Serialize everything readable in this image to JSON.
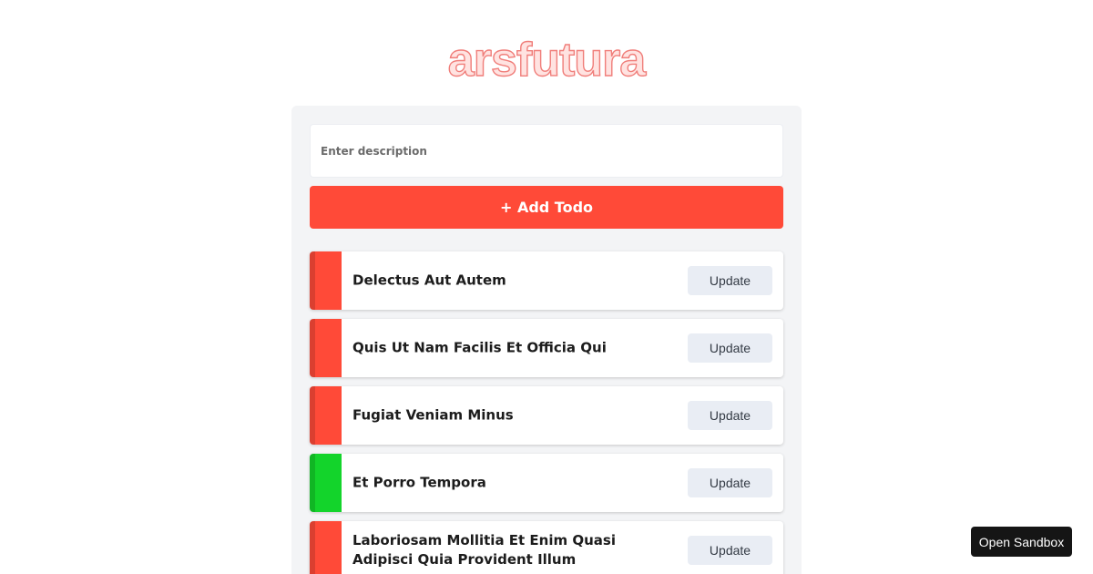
{
  "app": {
    "logo_text": "arsfutura"
  },
  "form": {
    "description_placeholder": "Enter description",
    "description_value": "",
    "add_button_label": "+ Add Todo"
  },
  "colors": {
    "accent": "#ff4a38",
    "pending_status": "#ff4a38",
    "done_status": "#13d42b",
    "panel_background": "#f3f4f6"
  },
  "todos": [
    {
      "title": "Delectus Aut Autem",
      "status": "pending",
      "status_color": "#ff4a38",
      "action_label": "Update"
    },
    {
      "title": "Quis Ut Nam Facilis Et Officia Qui",
      "status": "pending",
      "status_color": "#ff4a38",
      "action_label": "Update"
    },
    {
      "title": "Fugiat Veniam Minus",
      "status": "pending",
      "status_color": "#ff4a38",
      "action_label": "Update"
    },
    {
      "title": "Et Porro Tempora",
      "status": "done",
      "status_color": "#13d42b",
      "action_label": "Update"
    },
    {
      "title": "Laboriosam Mollitia Et Enim Quasi Adipisci Quia Provident Illum",
      "status": "pending",
      "status_color": "#ff4a38",
      "action_label": "Update"
    }
  ],
  "sandbox": {
    "button_label": "Open Sandbox"
  }
}
